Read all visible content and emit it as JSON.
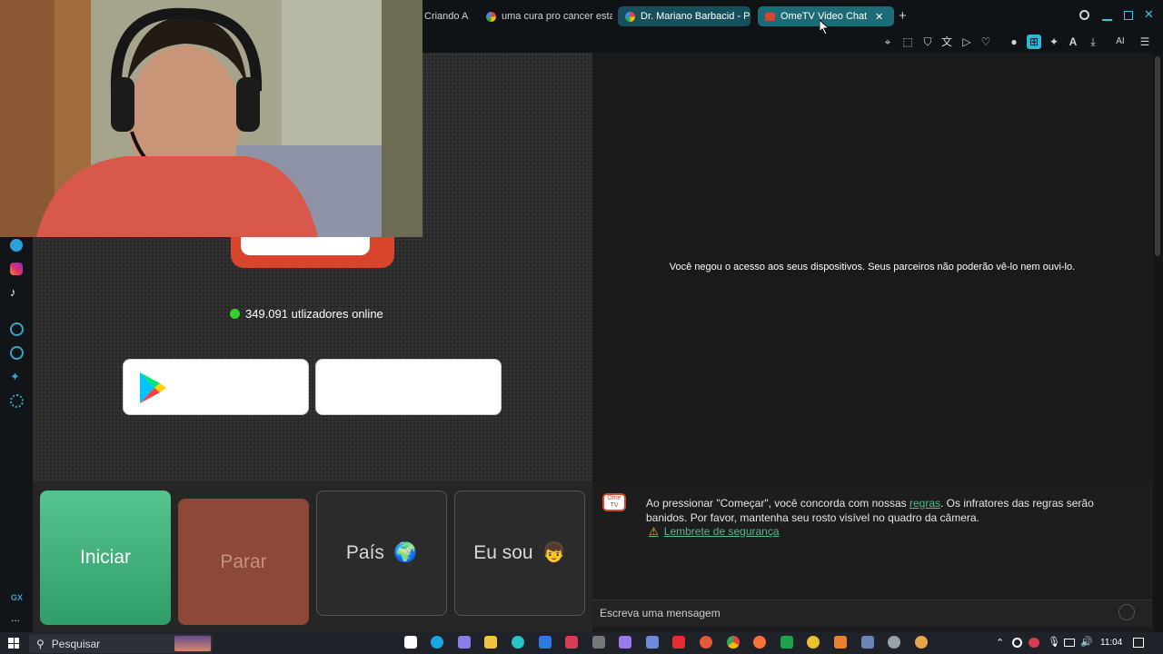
{
  "browser": {
    "tabs": [
      {
        "label": "Criando A",
        "active": false
      },
      {
        "label": "uma cura pro cancer esta",
        "active": false
      },
      {
        "label": "Dr. Mariano Barbacid - Pe",
        "active": false
      },
      {
        "label": "OmeTV Video Chat —",
        "active": true
      }
    ],
    "new_tab_icon": "+",
    "close_tab_icon": "✕",
    "ai_label": "AI"
  },
  "app": {
    "online_count_text": "349.091 utlizadores online",
    "denied_text": "Você negou o acesso aos seus dispositivos. Seus parceiros não poderão vê-lo nem ouvi-lo.",
    "buttons": {
      "start": "Iniciar",
      "stop": "Parar",
      "country": "País",
      "country_emoji": "🌍",
      "iam": "Eu sou",
      "iam_emoji": "👦"
    },
    "chat": {
      "logo_text": "Ome TV",
      "msg_before": "Ao pressionar \"Começar\", você concorda com nossas ",
      "msg_link": "regras",
      "msg_after": ". Os infratores das regras serão banidos. Por favor, mantenha seu rosto visível no quadro da câmera.",
      "safety_link": "Lembrete de segurança",
      "input_placeholder": "Escreva uma mensagem"
    }
  },
  "sidebar": {
    "gx_label": "GX",
    "more_label": "..."
  },
  "taskbar": {
    "search_label": "Pesquisar",
    "time": "11:04"
  },
  "colors": {
    "accent_tab": "#1e6b78",
    "start_green": "#3fae7a",
    "stop_red": "#8d4838",
    "link_green": "#56b98f"
  }
}
